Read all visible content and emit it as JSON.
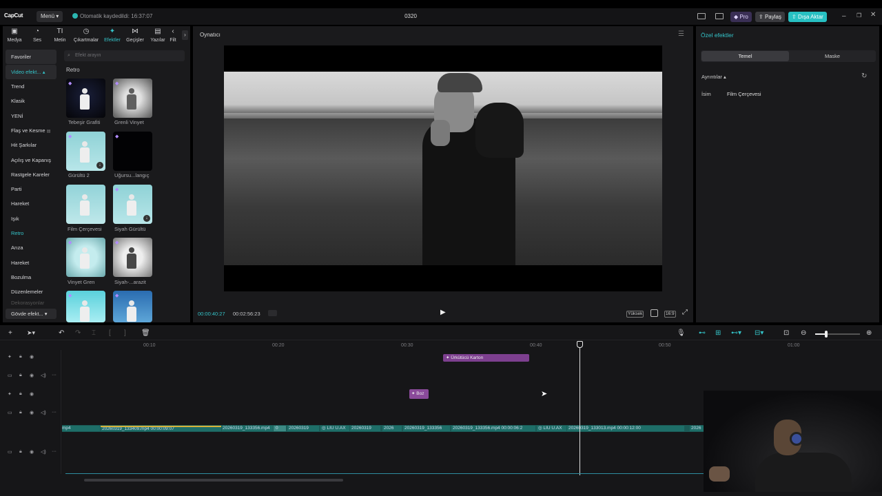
{
  "app": {
    "logo": "CapCut",
    "menu_label": "Menü",
    "autosave_text": "Otomatik kaydedildi: 16:37:07",
    "project_title": "0320",
    "pro_label": "Pro",
    "share_label": "Paylaş",
    "export_label": "Dışa Aktar",
    "accent_color": "#34c3c8"
  },
  "tabs": [
    {
      "label": "Medya",
      "icon": "media-icon"
    },
    {
      "label": "Ses",
      "icon": "audio-icon"
    },
    {
      "label": "Metin",
      "icon": "text-icon"
    },
    {
      "label": "Çıkartmalar",
      "icon": "sticker-icon"
    },
    {
      "label": "Efektler",
      "icon": "effects-icon"
    },
    {
      "label": "Geçişler",
      "icon": "transitions-icon"
    },
    {
      "label": "Yazılar",
      "icon": "captions-icon"
    },
    {
      "label": "Filt",
      "icon": "filters-icon"
    }
  ],
  "categories": {
    "favorites": "Favoriler",
    "video_effects": "Video efekt...",
    "items": [
      "Trend",
      "Klasik",
      "YENİ",
      "Flaş ve Kesme",
      "Hit Şarkılar",
      "Açılış ve Kapanış",
      "Rastgele Kareler",
      "Parti",
      "Hareket",
      "Işık",
      "Retro",
      "Arıza",
      "Hareket",
      "Bozulma",
      "Düzenlemeler",
      "Dekorasyonlar"
    ],
    "body_effects": "Gövde efekt..."
  },
  "effects": {
    "search_placeholder": "Efekt arayın",
    "section_title": "Retro",
    "items": [
      {
        "name": "Tebeşir Grafiti"
      },
      {
        "name": "Grenli Vinyet"
      },
      {
        "name": "Gürültü 2"
      },
      {
        "name": "Uğursu...langıç"
      },
      {
        "name": "Film Çerçevesi"
      },
      {
        "name": "Siyah Gürültü"
      },
      {
        "name": "Vinyet Gren"
      },
      {
        "name": "Siyah-...arazit"
      }
    ]
  },
  "player": {
    "title": "Oynatıcı",
    "current_time": "00:00:40:27",
    "total_time": "00:02:56:23",
    "quality": "Yüksek",
    "ratio": "16:9"
  },
  "details": {
    "title": "Özel efektler",
    "tab_basic": "Temel",
    "tab_mask": "Maske",
    "section": "Ayrıntılar",
    "name_label": "İsim",
    "name_value": "Film Çerçevesi"
  },
  "timeline": {
    "ruler": [
      "00:10",
      "00:20",
      "00:30",
      "00:40",
      "00:50",
      "01:00"
    ],
    "effect_clip_1": "Ürkütücü Karton",
    "effect_clip_2": "Boz",
    "main_track_labels": [
      "mp4",
      "20260319_133409.mp4  00:00:09:07",
      "20260319_133356.mp4",
      "0",
      "20260319",
      "LIU U.AX",
      "20260319",
      "2026",
      "20260319_133356",
      "20260319_133356.mp4  00:00:06:2",
      "LIU U.AX",
      "20260319_133013.mp4  00:00:12:00",
      "2026"
    ]
  }
}
